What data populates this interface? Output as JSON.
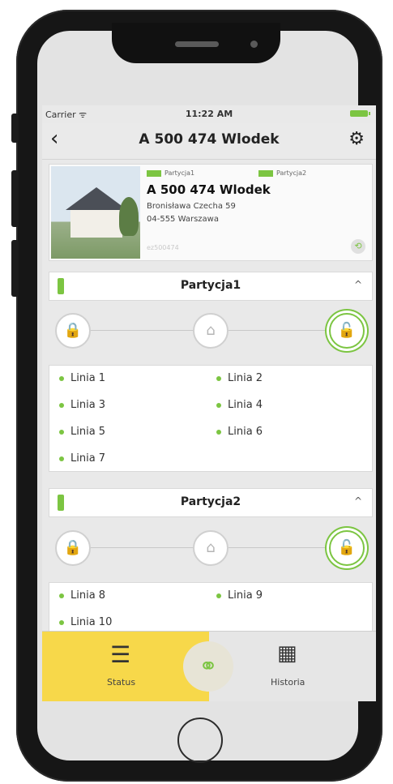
{
  "status_bar": {
    "carrier": "Carrier ᯤ",
    "time": "11:22 AM"
  },
  "nav": {
    "back_icon": "‹",
    "title": "A 500 474 Wlodek",
    "settings_icon": "⚙"
  },
  "site": {
    "tag1": "Partycja1",
    "tag2": "Partycja2",
    "name": "A 500 474 Wlodek",
    "address_line1": "Bronisława Czecha 59",
    "address_line2": "04-555 Warszawa",
    "id": "ez500474",
    "link_icon": "🔗"
  },
  "partitions": [
    {
      "name": "Partycja1",
      "caret": "^",
      "modes": [
        "lock-closed",
        "home",
        "lock-open"
      ],
      "lines": [
        "Linia 1",
        "Linia 2",
        "Linia 3",
        "Linia 4",
        "Linia 5",
        "Linia 6",
        "Linia 7"
      ]
    },
    {
      "name": "Partycja2",
      "caret": "^",
      "modes": [
        "lock-closed",
        "home",
        "lock-open"
      ],
      "lines": [
        "Linia 8",
        "Linia 9",
        "Linia 10"
      ]
    }
  ],
  "tabs": {
    "status_label": "Status",
    "history_label": "Historia"
  },
  "colors": {
    "accent_green": "#7cc542",
    "tab_yellow": "#f7d84a"
  }
}
